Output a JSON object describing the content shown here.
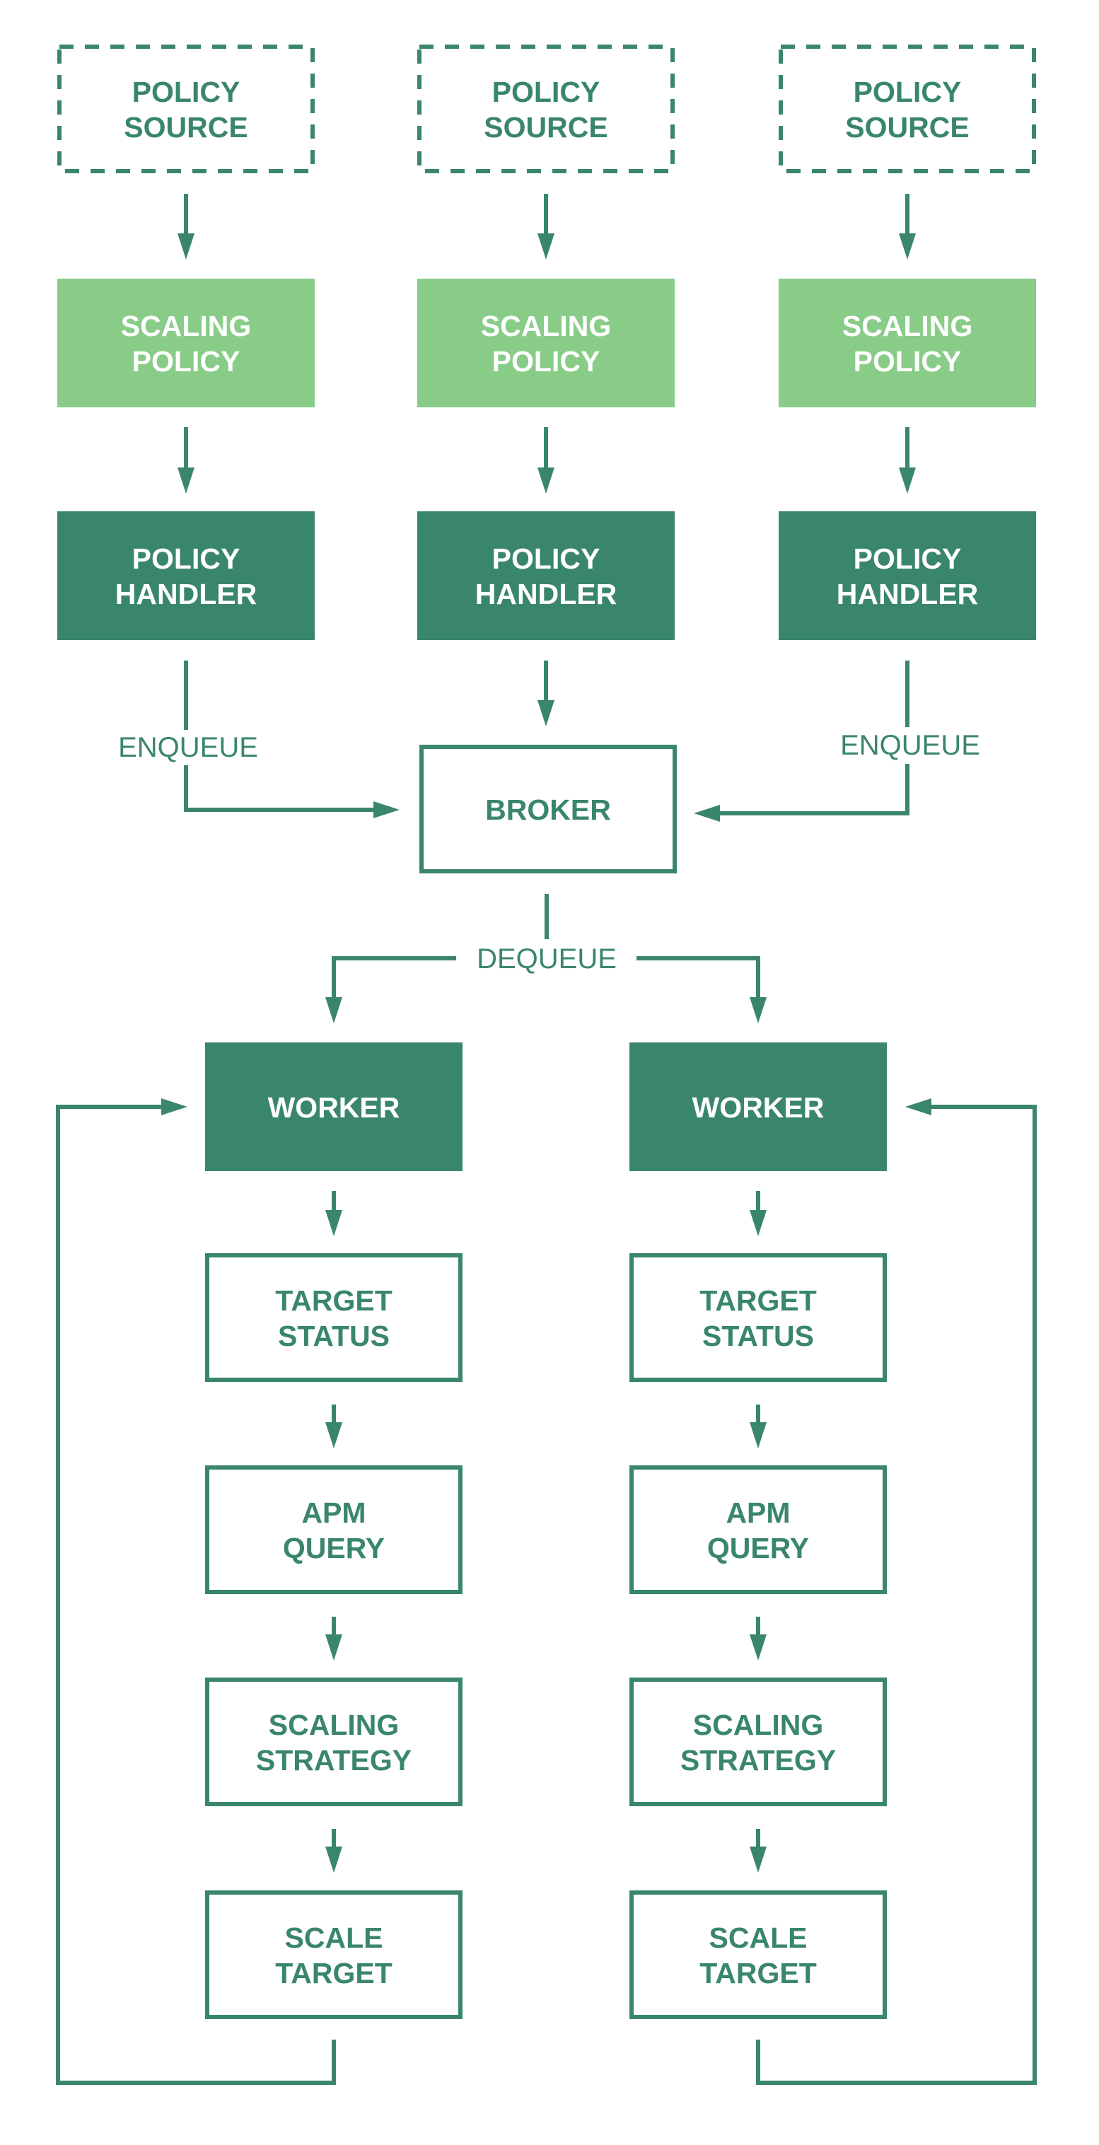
{
  "colors": {
    "dark_green": "#3a866c",
    "light_green": "#88cc88",
    "white": "#ffffff",
    "background": "#ffffff"
  },
  "nodes": [
    {
      "id": "policy-source-1",
      "style": "dashed",
      "lines": [
        "POLICY",
        "SOURCE"
      ]
    },
    {
      "id": "policy-source-2",
      "style": "dashed",
      "lines": [
        "POLICY",
        "SOURCE"
      ]
    },
    {
      "id": "policy-source-3",
      "style": "dashed",
      "lines": [
        "POLICY",
        "SOURCE"
      ]
    },
    {
      "id": "scaling-policy-1",
      "style": "light",
      "lines": [
        "SCALING",
        "POLICY"
      ]
    },
    {
      "id": "scaling-policy-2",
      "style": "light",
      "lines": [
        "SCALING",
        "POLICY"
      ]
    },
    {
      "id": "scaling-policy-3",
      "style": "light",
      "lines": [
        "SCALING",
        "POLICY"
      ]
    },
    {
      "id": "policy-handler-1",
      "style": "dark",
      "lines": [
        "POLICY",
        "HANDLER"
      ]
    },
    {
      "id": "policy-handler-2",
      "style": "dark",
      "lines": [
        "POLICY",
        "HANDLER"
      ]
    },
    {
      "id": "policy-handler-3",
      "style": "dark",
      "lines": [
        "POLICY",
        "HANDLER"
      ]
    },
    {
      "id": "broker",
      "style": "outline",
      "lines": [
        "BROKER"
      ]
    },
    {
      "id": "worker-1",
      "style": "dark",
      "lines": [
        "WORKER"
      ]
    },
    {
      "id": "worker-2",
      "style": "dark",
      "lines": [
        "WORKER"
      ]
    },
    {
      "id": "target-status-1",
      "style": "outline",
      "lines": [
        "TARGET",
        "STATUS"
      ]
    },
    {
      "id": "target-status-2",
      "style": "outline",
      "lines": [
        "TARGET",
        "STATUS"
      ]
    },
    {
      "id": "apm-query-1",
      "style": "outline",
      "lines": [
        "APM",
        "QUERY"
      ]
    },
    {
      "id": "apm-query-2",
      "style": "outline",
      "lines": [
        "APM",
        "QUERY"
      ]
    },
    {
      "id": "scaling-strategy-1",
      "style": "outline",
      "lines": [
        "SCALING",
        "STRATEGY"
      ]
    },
    {
      "id": "scaling-strategy-2",
      "style": "outline",
      "lines": [
        "SCALING",
        "STRATEGY"
      ]
    },
    {
      "id": "scale-target-1",
      "style": "outline",
      "lines": [
        "SCALE",
        "TARGET"
      ]
    },
    {
      "id": "scale-target-2",
      "style": "outline",
      "lines": [
        "SCALE",
        "TARGET"
      ]
    }
  ],
  "edges": [
    {
      "from": "policy-source-1",
      "to": "scaling-policy-1",
      "label": ""
    },
    {
      "from": "policy-source-2",
      "to": "scaling-policy-2",
      "label": ""
    },
    {
      "from": "policy-source-3",
      "to": "scaling-policy-3",
      "label": ""
    },
    {
      "from": "scaling-policy-1",
      "to": "policy-handler-1",
      "label": ""
    },
    {
      "from": "scaling-policy-2",
      "to": "policy-handler-2",
      "label": ""
    },
    {
      "from": "scaling-policy-3",
      "to": "policy-handler-3",
      "label": ""
    },
    {
      "from": "policy-handler-1",
      "to": "broker",
      "label": "ENQUEUE"
    },
    {
      "from": "policy-handler-2",
      "to": "broker",
      "label": ""
    },
    {
      "from": "policy-handler-3",
      "to": "broker",
      "label": "ENQUEUE"
    },
    {
      "from": "broker",
      "to": "worker-1",
      "label": "DEQUEUE"
    },
    {
      "from": "broker",
      "to": "worker-2",
      "label": "DEQUEUE"
    },
    {
      "from": "worker-1",
      "to": "target-status-1",
      "label": ""
    },
    {
      "from": "worker-2",
      "to": "target-status-2",
      "label": ""
    },
    {
      "from": "target-status-1",
      "to": "apm-query-1",
      "label": ""
    },
    {
      "from": "target-status-2",
      "to": "apm-query-2",
      "label": ""
    },
    {
      "from": "apm-query-1",
      "to": "scaling-strategy-1",
      "label": ""
    },
    {
      "from": "apm-query-2",
      "to": "scaling-strategy-2",
      "label": ""
    },
    {
      "from": "scaling-strategy-1",
      "to": "scale-target-1",
      "label": ""
    },
    {
      "from": "scaling-strategy-2",
      "to": "scale-target-2",
      "label": ""
    },
    {
      "from": "scale-target-1",
      "to": "worker-1",
      "label": ""
    },
    {
      "from": "scale-target-2",
      "to": "worker-2",
      "label": ""
    }
  ],
  "labels": {
    "enqueue_left": "ENQUEUE",
    "enqueue_right": "ENQUEUE",
    "dequeue": "DEQUEUE"
  }
}
